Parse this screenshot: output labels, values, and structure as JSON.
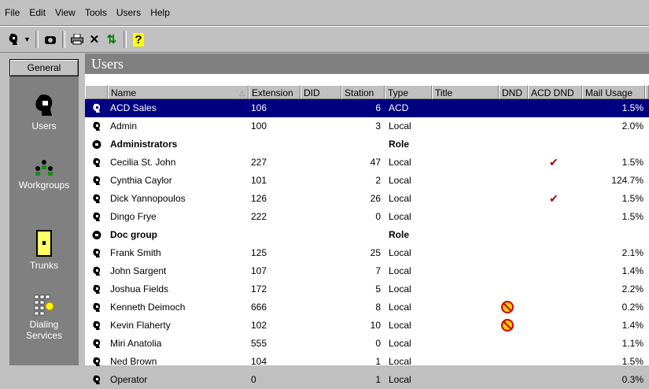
{
  "menu": [
    "File",
    "Edit",
    "View",
    "Tools",
    "Users",
    "Help"
  ],
  "toolbar": [
    "user-menu",
    "phone",
    "print",
    "delete",
    "refresh",
    "help"
  ],
  "nav": {
    "header": "General",
    "items": [
      {
        "label": "Users",
        "icon": "user-head-icon"
      },
      {
        "label": "Workgroups",
        "icon": "workgroup-icon"
      },
      {
        "label": "Trunks",
        "icon": "trunk-icon"
      },
      {
        "label": "Dialing Services",
        "icon": "dialing-services-icon"
      }
    ]
  },
  "main": {
    "title": "Users",
    "columns": [
      "Name",
      "Extension",
      "DID",
      "Station",
      "Type",
      "Title",
      "DND",
      "ACD DND",
      "Mail Usage"
    ],
    "rows": [
      {
        "name": "ACD Sales",
        "extension": "106",
        "did": "",
        "station": "6",
        "type": "ACD",
        "title": "",
        "dnd": false,
        "acd_dnd": false,
        "mail": "1.5%",
        "selected": true,
        "bold": false
      },
      {
        "name": "Admin",
        "extension": "100",
        "did": "",
        "station": "3",
        "type": "Local",
        "title": "",
        "dnd": false,
        "acd_dnd": false,
        "mail": "2.0%",
        "selected": false,
        "bold": false
      },
      {
        "name": "Administrators",
        "extension": "",
        "did": "",
        "station": "",
        "type": "Role",
        "title": "",
        "dnd": false,
        "acd_dnd": false,
        "mail": "",
        "selected": false,
        "bold": true
      },
      {
        "name": "Cecilia St. John",
        "extension": "227",
        "did": "",
        "station": "47",
        "type": "Local",
        "title": "",
        "dnd": false,
        "acd_dnd": true,
        "mail": "1.5%",
        "selected": false,
        "bold": false
      },
      {
        "name": "Cynthia Caylor",
        "extension": "101",
        "did": "",
        "station": "2",
        "type": "Local",
        "title": "",
        "dnd": false,
        "acd_dnd": false,
        "mail": "124.7%",
        "selected": false,
        "bold": false
      },
      {
        "name": "Dick Yannopoulos",
        "extension": "126",
        "did": "",
        "station": "26",
        "type": "Local",
        "title": "",
        "dnd": false,
        "acd_dnd": true,
        "mail": "1.5%",
        "selected": false,
        "bold": false
      },
      {
        "name": "Dingo Frye",
        "extension": "222",
        "did": "",
        "station": "0",
        "type": "Local",
        "title": "",
        "dnd": false,
        "acd_dnd": false,
        "mail": "1.5%",
        "selected": false,
        "bold": false
      },
      {
        "name": "Doc group",
        "extension": "",
        "did": "",
        "station": "",
        "type": "Role",
        "title": "",
        "dnd": false,
        "acd_dnd": false,
        "mail": "",
        "selected": false,
        "bold": true
      },
      {
        "name": "Frank Smith",
        "extension": "125",
        "did": "",
        "station": "25",
        "type": "Local",
        "title": "",
        "dnd": false,
        "acd_dnd": false,
        "mail": "2.1%",
        "selected": false,
        "bold": false
      },
      {
        "name": "John Sargent",
        "extension": "107",
        "did": "",
        "station": "7",
        "type": "Local",
        "title": "",
        "dnd": false,
        "acd_dnd": false,
        "mail": "1.4%",
        "selected": false,
        "bold": false
      },
      {
        "name": "Joshua Fields",
        "extension": "172",
        "did": "",
        "station": "5",
        "type": "Local",
        "title": "",
        "dnd": false,
        "acd_dnd": false,
        "mail": "2.2%",
        "selected": false,
        "bold": false
      },
      {
        "name": "Kenneth Deimoch",
        "extension": "666",
        "did": "",
        "station": "8",
        "type": "Local",
        "title": "",
        "dnd": true,
        "acd_dnd": false,
        "mail": "0.2%",
        "selected": false,
        "bold": false
      },
      {
        "name": "Kevin Flaherty",
        "extension": "102",
        "did": "",
        "station": "10",
        "type": "Local",
        "title": "",
        "dnd": true,
        "acd_dnd": false,
        "mail": "1.4%",
        "selected": false,
        "bold": false
      },
      {
        "name": "Miri Anatolia",
        "extension": "555",
        "did": "",
        "station": "0",
        "type": "Local",
        "title": "",
        "dnd": false,
        "acd_dnd": false,
        "mail": "1.1%",
        "selected": false,
        "bold": false
      },
      {
        "name": "Ned Brown",
        "extension": "104",
        "did": "",
        "station": "1",
        "type": "Local",
        "title": "",
        "dnd": false,
        "acd_dnd": false,
        "mail": "1.5%",
        "selected": false,
        "bold": false
      },
      {
        "name": "Operator",
        "extension": "0",
        "did": "",
        "station": "1",
        "type": "Local",
        "title": "",
        "dnd": false,
        "acd_dnd": false,
        "mail": "0.3%",
        "selected": false,
        "bold": false
      }
    ]
  },
  "colors": {
    "selection": "#000080",
    "chrome": "#c0c0c0",
    "panel_dark": "#808080",
    "check": "#b00000",
    "dnd_red": "#d00000"
  }
}
